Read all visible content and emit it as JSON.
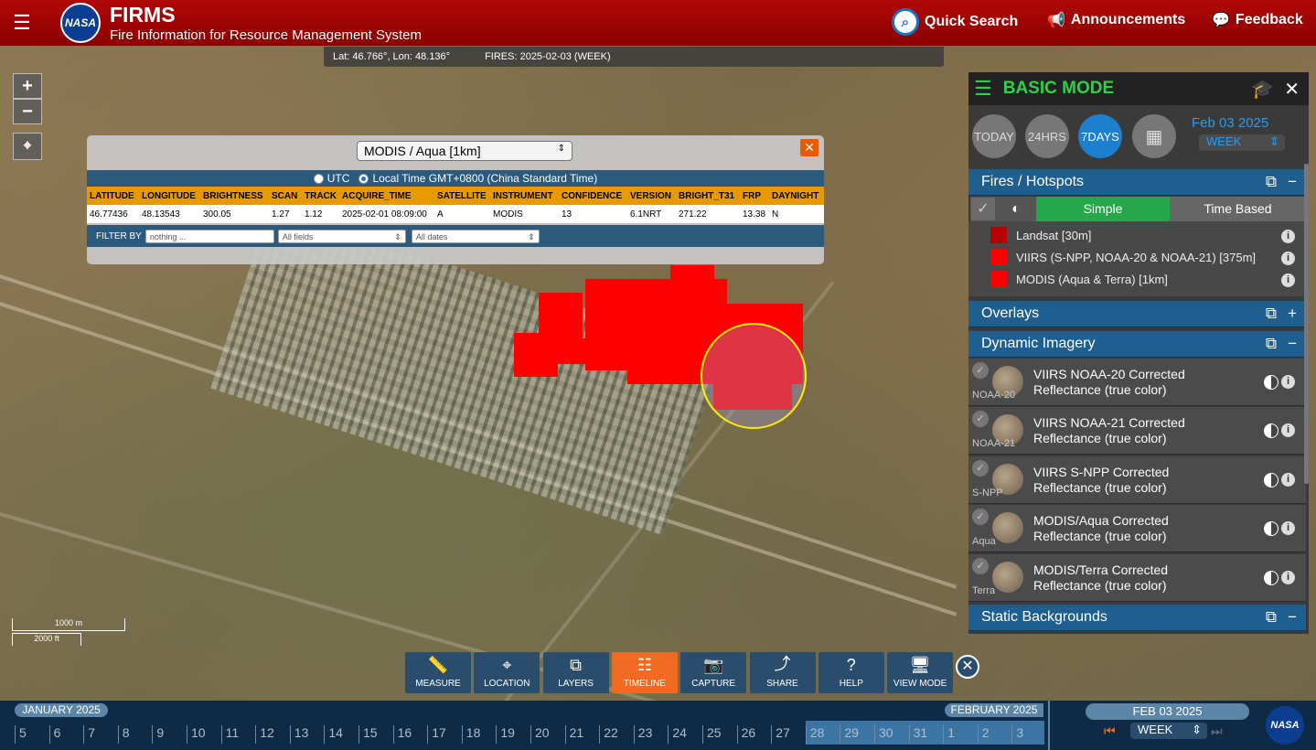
{
  "header": {
    "title": "FIRMS",
    "subtitle": "Fire Information for Resource Management System",
    "nasa_logo_text": "NASA",
    "quick_search": "Quick Search",
    "announcements": "Announcements",
    "feedback": "Feedback"
  },
  "coords": {
    "latlon": "Lat: 46.766°, Lon: 48.136°",
    "fires": "FIRES: 2025-02-03 (WEEK)"
  },
  "popup": {
    "source": "MODIS / Aqua [1km]",
    "utc": "UTC",
    "local_time": "Local Time GMT+0800 (China Standard Time)",
    "columns": [
      "LATITUDE",
      "LONGITUDE",
      "BRIGHTNESS",
      "SCAN",
      "TRACK",
      "ACQUIRE_TIME",
      "SATELLITE",
      "INSTRUMENT",
      "CONFIDENCE",
      "VERSION",
      "BRIGHT_T31",
      "FRP",
      "DAYNIGHT"
    ],
    "row": [
      "46.77436",
      "48.13543",
      "300.05",
      "1.27",
      "1.12",
      "2025-02-01 08:09:00",
      "A",
      "MODIS",
      "13",
      "6.1NRT",
      "271.22",
      "13.38",
      "N"
    ],
    "filter_by": "FILTER BY",
    "filter_placeholder": "nothing ...",
    "field_select": "All fields",
    "date_select": "All dates"
  },
  "scale": {
    "metric": "1000 m",
    "imperial": "2000 ft"
  },
  "panel": {
    "mode": "BASIC MODE",
    "buttons": [
      "TODAY",
      "24HRS",
      "7DAYS"
    ],
    "date": "Feb 03 2025",
    "period": "WEEK",
    "fires_title": "Fires / Hotspots",
    "simple": "Simple",
    "time_based": "Time Based",
    "legend": [
      {
        "label": "Landsat [30m]",
        "color": "#b40000"
      },
      {
        "label": "VIIRS (S-NPP, NOAA-20 & NOAA-21) [375m]",
        "color": "#ff0000"
      },
      {
        "label": "MODIS (Aqua & Terra) [1km]",
        "color": "#ff0000"
      }
    ],
    "overlays_title": "Overlays",
    "dynamic_title": "Dynamic Imagery",
    "imagery": [
      {
        "line1": "VIIRS NOAA-20 Corrected",
        "line2": "Reflectance (true color)",
        "sat": "NOAA-20"
      },
      {
        "line1": "VIIRS NOAA-21 Corrected",
        "line2": "Reflectance (true color)",
        "sat": "NOAA-21"
      },
      {
        "line1": "VIIRS S-NPP Corrected",
        "line2": "Reflectance (true color)",
        "sat": "S-NPP"
      },
      {
        "line1": "MODIS/Aqua Corrected",
        "line2": "Reflectance (true color)",
        "sat": "Aqua"
      },
      {
        "line1": "MODIS/Terra Corrected",
        "line2": "Reflectance (true color)",
        "sat": "Terra"
      }
    ],
    "static_title": "Static Backgrounds"
  },
  "toolbar": [
    "MEASURE",
    "LOCATION",
    "LAYERS",
    "TIMELINE",
    "CAPTURE",
    "SHARE",
    "HELP",
    "VIEW MODE"
  ],
  "timeline": {
    "month1": "JANUARY 2025",
    "month2": "FEBRUARY 2025",
    "days": [
      "5",
      "6",
      "7",
      "8",
      "9",
      "10",
      "11",
      "12",
      "13",
      "14",
      "15",
      "16",
      "17",
      "18",
      "19",
      "20",
      "21",
      "22",
      "23",
      "24",
      "25",
      "26",
      "27",
      "28",
      "29",
      "30",
      "31",
      "1",
      "2",
      "3"
    ],
    "date": "FEB 03 2025",
    "period": "WEEK"
  }
}
